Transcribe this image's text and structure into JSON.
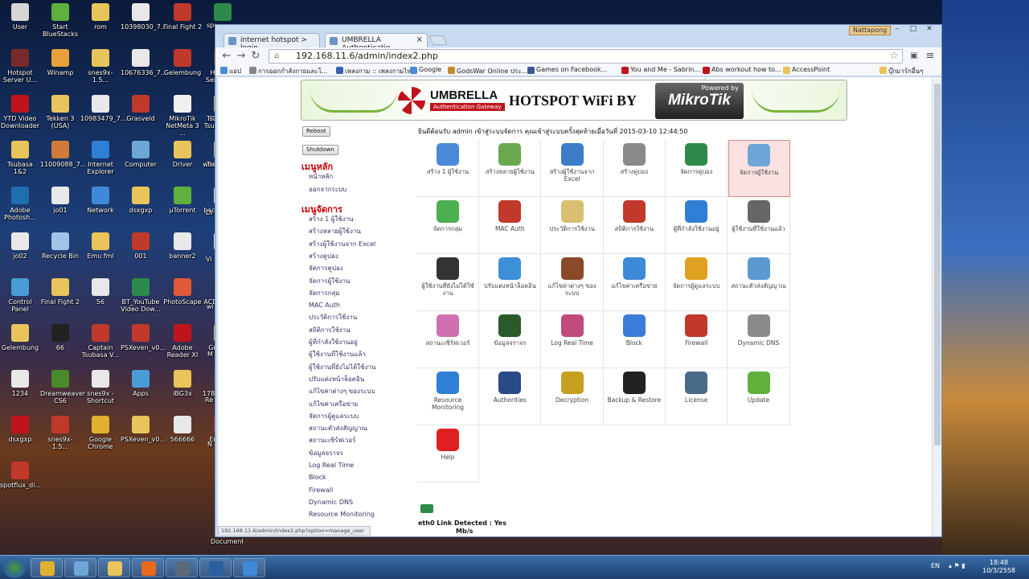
{
  "desktop": {
    "icons": [
      {
        "label": "User",
        "color": "#d6d6d6"
      },
      {
        "label": "Start BlueStacks",
        "color": "#5fb03c"
      },
      {
        "label": "rom",
        "color": "#e8c45a"
      },
      {
        "label": "10398030_7...",
        "color": "#e8e8e8"
      },
      {
        "label": "Final Fight 2",
        "color": "#c0392b"
      },
      {
        "label": "spe",
        "color": "#2d8a4a"
      },
      {
        "label": "Hotspot Server U...",
        "color": "#7a2a2a"
      },
      {
        "label": "Winamp",
        "color": "#e8a13a"
      },
      {
        "label": "snes9x-1.5...",
        "color": "#e8c45a"
      },
      {
        "label": "10676336_7...",
        "color": "#e8e8e8"
      },
      {
        "label": "Gelembung",
        "color": "#c0392b"
      },
      {
        "label": "Hotspot Server U...",
        "color": "#7a2a2a"
      },
      {
        "label": "YTD Video Downloader",
        "color": "#c0141c"
      },
      {
        "label": "Tekken 3 (USA)",
        "color": "#e8c45a"
      },
      {
        "label": "10983479_7...",
        "color": "#e8e8e8"
      },
      {
        "label": "Grasveld",
        "color": "#c0392b"
      },
      {
        "label": "MikroTik NetMeta 3 ...",
        "color": "#f0f0f0"
      },
      {
        "label": "Captain Tsubasa V...",
        "color": "#e8c45a"
      },
      {
        "label": "Tsubasa 1&2",
        "color": "#e8c45a"
      },
      {
        "label": "11009088_7...",
        "color": "#d27a3a"
      },
      {
        "label": "Internet Explorer",
        "color": "#2f7fd6"
      },
      {
        "label": "Computer",
        "color": "#6fa6d8"
      },
      {
        "label": "Driver",
        "color": "#e8c45a"
      },
      {
        "label": "winbox_ve...",
        "color": "#e8c45a"
      },
      {
        "label": "Adobe Photosh...",
        "color": "#1f6fb0"
      },
      {
        "label": "jo01",
        "color": "#e8e8e8"
      },
      {
        "label": "Network",
        "color": "#3c8ad8"
      },
      {
        "label": "dsxgxp",
        "color": "#e8c45a"
      },
      {
        "label": "µTorrent",
        "color": "#5fb03c"
      },
      {
        "label": "background",
        "color": "#e8e8e8"
      },
      {
        "label": "jo02",
        "color": "#e8e8e8"
      },
      {
        "label": "Recycle Bin",
        "color": "#9fc4e8"
      },
      {
        "label": "Emu fml",
        "color": "#e8c45a"
      },
      {
        "label": "001",
        "color": "#c0392b"
      },
      {
        "label": "banner2",
        "color": "#e8e8e8"
      },
      {
        "label": "jo03",
        "color": "#e8e8e8"
      },
      {
        "label": "Control Panel",
        "color": "#4a9cd6"
      },
      {
        "label": "Final Fight 2",
        "color": "#e8c45a"
      },
      {
        "label": "56",
        "color": "#e8e8e8"
      },
      {
        "label": "BT_YouTube Video Dow...",
        "color": "#2d8a4a"
      },
      {
        "label": "PhotoScape",
        "color": "#e05a3a"
      },
      {
        "label": "ACDSee Pro 3",
        "color": "#2a2a2a"
      },
      {
        "label": "Gelembung",
        "color": "#e8c45a"
      },
      {
        "label": "66",
        "color": "#222222"
      },
      {
        "label": "Captain Tsubasa V...",
        "color": "#c0392b"
      },
      {
        "label": "PSXeven_v0...",
        "color": "#c0392b"
      },
      {
        "label": "Adobe Reader XI",
        "color": "#c0141c"
      },
      {
        "label": "Grasveld",
        "color": "#e8c45a"
      },
      {
        "label": "1234",
        "color": "#e8e8e8"
      },
      {
        "label": "Dreamweaver CS6",
        "color": "#4a8a2a"
      },
      {
        "label": "snes9x - Shortcut",
        "color": "#e8e8e8"
      },
      {
        "label": "Apps",
        "color": "#4a9cd6"
      },
      {
        "label": "iBG3x",
        "color": "#e8c45a"
      },
      {
        "label": "17888_7836...",
        "color": "#444444"
      },
      {
        "label": "dsxgxp",
        "color": "#c0141c"
      },
      {
        "label": "snes9x-1.5...",
        "color": "#c0392b"
      },
      {
        "label": "Google Chrome",
        "color": "#e0b030"
      },
      {
        "label": "PSXeven_v0...",
        "color": "#e8c45a"
      },
      {
        "label": "566666",
        "color": "#e8e8e8"
      },
      {
        "label": "Emu fml",
        "color": "#c0392b"
      },
      {
        "label": "spotflux_di...",
        "color": "#c0392b"
      }
    ],
    "right_fragments": [
      "spe",
      "Tsu",
      "Tsu",
      "Dr",
      "Vi",
      "wi",
      "M",
      "Re",
      "N",
      "Document"
    ]
  },
  "browser": {
    "tabs": [
      {
        "title": "internet hotspot > login"
      },
      {
        "title": "UMBRELLA Authenticatio"
      }
    ],
    "tab_close": "×",
    "user_badge": "Nattapong",
    "window_controls": [
      "–",
      "□",
      "✕"
    ],
    "nav": {
      "back": "←",
      "forward": "→",
      "reload": "↻",
      "home": "⌂",
      "star": "☆",
      "url": "192.168.11.6/admin/index2.php"
    },
    "bookmarks": [
      {
        "label": "แอป",
        "color": "#4a8ad8"
      },
      {
        "label": "การออกกำลังกายและโ...",
        "color": "#888888"
      },
      {
        "label": "เพลงกาม :: เพลงกามไท...",
        "color": "#3a5fb0"
      },
      {
        "label": "Google",
        "color": "#4a8ad8"
      },
      {
        "label": "GodsWar Online ประ...",
        "color": "#c08a2a"
      },
      {
        "label": "Games on Facebook...",
        "color": "#3b5998"
      },
      {
        "label": "You and Me - Sabrin...",
        "color": "#c0141c"
      },
      {
        "label": "Abs workout how to...",
        "color": "#c0141c"
      },
      {
        "label": "AccessPoint",
        "color": "#e8c45a"
      },
      {
        "label": "บุ๊กมาร์กอื่นๆ",
        "color": "#e8c45a"
      }
    ],
    "status_url": "192.168.11.6/admin/index2.php?option=manage_user"
  },
  "page": {
    "banner": {
      "brand": "UMBRELLA",
      "brand_sub": "Authentication Gateway",
      "headline": "HOTSPOT WiFi BY",
      "powered_by": "Powered by",
      "mikrotik": "MikroTik"
    },
    "buttons": {
      "reboot": "Reboot",
      "shutdown": "Shutdown"
    },
    "menu_main_title": "เมนูหลัก",
    "menu_main": [
      "หน้าหลัก",
      "ออกจากระบบ"
    ],
    "menu_manage_title": "เมนูจัดการ",
    "menu_manage": [
      "สร้าง 1 ผู้ใช้งาน",
      "สร้างหลายผู้ใช้งาน",
      "สร้างผู้ใช้งานจาก Excel",
      "สร้างคูปอง",
      "จัดการคูปอง",
      "จัดการผู้ใช้งาน",
      "จัดการกลุ่ม",
      "MAC Auth",
      "ประวัติการใช้งาน",
      "สถิติการใช้งาน",
      "ผู้ที่กำลังใช้งานอยู่",
      "ผู้ใช้งานที่ใช้งานแล้ว",
      "ผู้ใช้งานที่ยังไม่ได้ใช้งาน",
      "ปรับแต่งหน้าล็อคอิน",
      "แก้ไขค่าต่างๆ ของระบบ",
      "แก้ไขค่าเครือข่าย",
      "จัดการผู้ดูแลระบบ",
      "สถานะตัวส่งสัญญาณ",
      "สถานะเซิร์ฟเวอร์",
      "ข้อมูลจราจร",
      "Log Real Time",
      "Block",
      "Firewall",
      "Dynamic DNS",
      "Resource Monitoring"
    ],
    "welcome": "ยินดีต้อนรับ admin เข้าสู่ระบบจัดการ คุณเข้าสู่ระบบครั้งสุดท้ายเมื่อวันที่ 2015-03-10 12:44:50",
    "grid": [
      {
        "label": "สร้าง 1 ผู้ใช้งาน",
        "color": "#4a8ad8"
      },
      {
        "label": "สร้างหลายผู้ใช้งาน",
        "color": "#6aa84f"
      },
      {
        "label": "สร้างผู้ใช้งานจาก Excel",
        "color": "#3d7cc9"
      },
      {
        "label": "สร้างคูปอง",
        "color": "#8a8a8a"
      },
      {
        "label": "จัดการคูปอง",
        "color": "#2d8a4a"
      },
      {
        "label": "จัดการผู้ใช้งาน",
        "color": "#6fa6d8",
        "selected": true
      },
      {
        "label": "จัดการกลุ่ม",
        "color": "#4caf50"
      },
      {
        "label": "MAC Auth",
        "color": "#c0392b"
      },
      {
        "label": "ประวัติการใช้งาน",
        "color": "#d8c070"
      },
      {
        "label": "สถิติการใช้งาน",
        "color": "#c0392b"
      },
      {
        "label": "ผู้ที่กำลังใช้งานอยู่",
        "color": "#2f7fd6"
      },
      {
        "label": "ผู้ใช้งานที่ใช้งานแล้ว",
        "color": "#666666"
      },
      {
        "label": "ผู้ใช้งานที่ยังไม่ได้ใช้งาน",
        "color": "#333333"
      },
      {
        "label": "ปรับแต่งหน้าล็อคอิน",
        "color": "#3d8fd8"
      },
      {
        "label": "แก้ไขค่าต่างๆ ของระบบ",
        "color": "#8a4a2a"
      },
      {
        "label": "แก้ไขค่าเครือข่าย",
        "color": "#3c8ad8"
      },
      {
        "label": "จัดการผู้ดูแลระบบ",
        "color": "#e0a020"
      },
      {
        "label": "สถานะตัวส่งสัญญาณ",
        "color": "#5a9ad0"
      },
      {
        "label": "สถานะเซิร์ฟเวอร์",
        "color": "#d070b0"
      },
      {
        "label": "ข้อมูลจราจร",
        "color": "#2a5a2a"
      },
      {
        "label": "Log Real Time",
        "color": "#c04a7a"
      },
      {
        "label": "Block",
        "color": "#3c7cd8"
      },
      {
        "label": "Firewall",
        "color": "#c0392b"
      },
      {
        "label": "Dynamic DNS",
        "color": "#8a8a8a"
      },
      {
        "label": "Resource Monitoring",
        "color": "#2f7fd6"
      },
      {
        "label": "Authorities",
        "color": "#2a4a8a"
      },
      {
        "label": "Decryption",
        "color": "#c8a020"
      },
      {
        "label": "Backup & Restore",
        "color": "#222222"
      },
      {
        "label": "License",
        "color": "#4a6a8a"
      },
      {
        "label": "Update",
        "color": "#5fb03c"
      },
      {
        "label": "Help",
        "color": "#e02020"
      }
    ],
    "link_status": "eth0 Link Detected : Yes",
    "speed": "Mb/s"
  },
  "taskbar": {
    "apps": [
      {
        "name": "chrome",
        "color": "#e0b030"
      },
      {
        "name": "network-tool",
        "color": "#6fa6d8"
      },
      {
        "name": "explorer",
        "color": "#e8c45a"
      },
      {
        "name": "media-player",
        "color": "#e86a1a"
      },
      {
        "name": "winbox",
        "color": "#5a6a7a"
      },
      {
        "name": "mikrotik",
        "color": "#2a5fa0"
      },
      {
        "name": "app",
        "color": "#3c8ad8"
      }
    ],
    "lang": "EN",
    "time": "18:48",
    "date": "10/3/2558"
  }
}
